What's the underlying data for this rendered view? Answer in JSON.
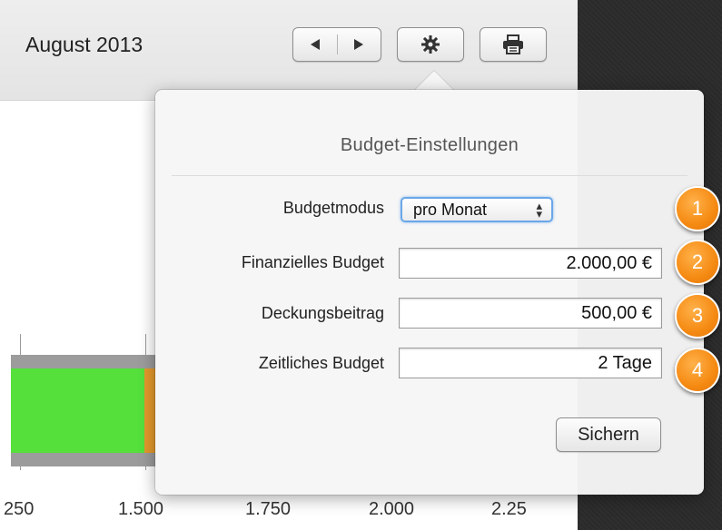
{
  "toolbar": {
    "month_title": "August 2013",
    "prev_icon": "triangle-left-icon",
    "next_icon": "triangle-right-icon",
    "settings_icon": "gear-icon",
    "print_icon": "printer-icon"
  },
  "chart": {
    "tick_labels": [
      "250",
      "1.500",
      "1.750",
      "2.000",
      "2.25"
    ]
  },
  "popover": {
    "title": "Budget-Einstellungen",
    "fields": {
      "mode_label": "Budgetmodus",
      "mode_value": "pro Monat",
      "financial_label": "Finanzielles Budget",
      "financial_value": "2.000,00 €",
      "contribution_label": "Deckungsbeitrag",
      "contribution_value": "500,00 €",
      "time_label": "Zeitliches Budget",
      "time_value": "2 Tage"
    },
    "save_label": "Sichern"
  },
  "callouts": [
    "1",
    "2",
    "3",
    "4"
  ],
  "colors": {
    "accent_orange": "#f58a12",
    "bar_green": "#55e03c",
    "bar_orange": "#e49a2c",
    "focus_blue": "#6aa7e8"
  }
}
